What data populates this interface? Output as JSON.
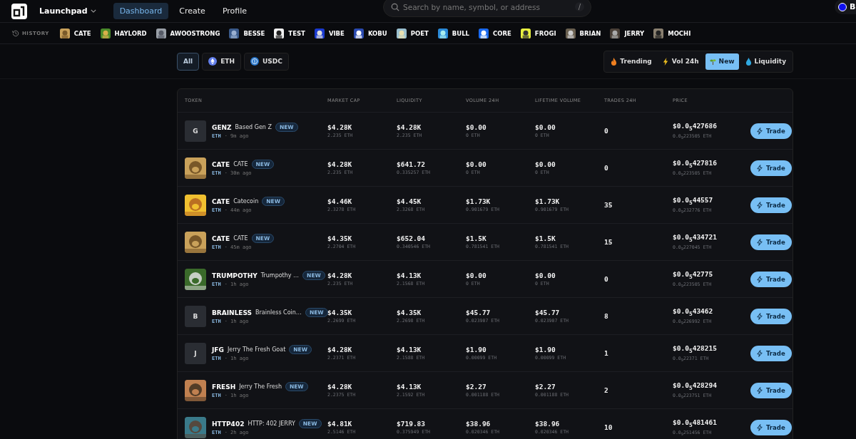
{
  "nav": {
    "brand": "Launchpad",
    "links": [
      {
        "label": "Dashboard",
        "selected": true
      },
      {
        "label": "Create",
        "selected": false
      },
      {
        "label": "Profile",
        "selected": false
      }
    ]
  },
  "search": {
    "placeholder": "Search by name, symbol, or address",
    "shortcut": "/"
  },
  "account": {
    "label": "B"
  },
  "history": {
    "label": "HISTORY",
    "items": [
      "CATE",
      "HAYLORD",
      "AWOOSTRONG",
      "BESSE",
      "TEST",
      "VIBE",
      "KOBU",
      "POET",
      "BULL",
      "CORE",
      "FROGI",
      "BRIAN",
      "JERRY",
      "MOCHI"
    ]
  },
  "chains": [
    {
      "label": "All",
      "kind": "all",
      "selected": true
    },
    {
      "label": "ETH",
      "kind": "eth",
      "selected": false
    },
    {
      "label": "USDC",
      "kind": "usdc",
      "selected": false
    }
  ],
  "sorts": [
    {
      "label": "Trending",
      "kind": "fire",
      "selected": false
    },
    {
      "label": "Vol 24h",
      "kind": "bolt",
      "selected": false
    },
    {
      "label": "New",
      "kind": "sprout",
      "selected": true
    },
    {
      "label": "Liquidity",
      "kind": "drop",
      "selected": false
    }
  ],
  "table": {
    "columns": [
      "TOKEN",
      "MARKET CAP",
      "LIQUIDITY",
      "VOLUME 24H",
      "LIFETIME VOLUME",
      "TRADES 24H",
      "PRICE"
    ],
    "rows": [
      {
        "avatar": {
          "kind": "letter",
          "letter": "G"
        },
        "symbol": "GENZ",
        "name": "Based Gen Z",
        "badge": "NEW",
        "chain": "ETH",
        "age": "· 9m ago",
        "mcap": "$4.28K",
        "mcap_eth": "2.235 ETH",
        "liq": "$4.28K",
        "liq_eth": "2.235 ETH",
        "vol": "$0.00",
        "vol_eth": "0 ETH",
        "life": "$0.00",
        "life_eth": "0 ETH",
        "trades": "0",
        "price": "$0.0$_{5}$427686",
        "price_eth": "0.0$_{9}$223505 ETH",
        "action": "Trade"
      },
      {
        "symbol": "CATE",
        "name": "CATE",
        "badge": "NEW",
        "chain": "ETH",
        "age": "· 30m ago",
        "mcap": "$4.28K",
        "mcap_eth": "2.235 ETH",
        "liq": "$641.72",
        "liq_eth": "0.335257 ETH",
        "vol": "$0.00",
        "vol_eth": "0 ETH",
        "life": "$0.00",
        "life_eth": "0 ETH",
        "trades": "0",
        "price": "$0.0$_{5}$427816",
        "price_eth": "0.0$_{9}$223505 ETH",
        "action": "Trade"
      },
      {
        "symbol": "CATE",
        "name": "Catecoin",
        "badge": "NEW",
        "chain": "ETH",
        "age": "· 44m ago",
        "mcap": "$4.46K",
        "mcap_eth": "2.3278 ETH",
        "liq": "$4.45K",
        "liq_eth": "2.3268 ETH",
        "vol": "$1.73K",
        "vol_eth": "0.901679 ETH",
        "life": "$1.73K",
        "life_eth": "0.901679 ETH",
        "trades": "35",
        "price": "$0.0$_{5}$44557",
        "price_eth": "0.0$_{9}$232776 ETH",
        "action": "Trade"
      },
      {
        "symbol": "CATE",
        "name": "CATE",
        "badge": "NEW",
        "chain": "ETH",
        "age": "· 45m ago",
        "mcap": "$4.35K",
        "mcap_eth": "2.2704 ETH",
        "liq": "$652.04",
        "liq_eth": "0.340546 ETH",
        "vol": "$1.5K",
        "vol_eth": "0.781541 ETH",
        "life": "$1.5K",
        "life_eth": "0.781541 ETH",
        "trades": "15",
        "price": "$0.0$_{5}$434721",
        "price_eth": "0.0$_{9}$227045 ETH",
        "action": "Trade"
      },
      {
        "symbol": "TRUMPOTHY",
        "name": "Trumpothy …",
        "badge": "NEW",
        "chain": "ETH",
        "age": "· 1h ago",
        "mcap": "$4.28K",
        "mcap_eth": "2.235 ETH",
        "liq": "$4.13K",
        "liq_eth": "2.1568 ETH",
        "vol": "$0.00",
        "vol_eth": "0 ETH",
        "life": "$0.00",
        "life_eth": "0 ETH",
        "trades": "0",
        "price": "$0.0$_{5}$42775",
        "price_eth": "0.0$_{9}$223505 ETH",
        "action": "Trade"
      },
      {
        "avatar": {
          "kind": "letter",
          "letter": "B"
        },
        "symbol": "BRAINLESS",
        "name": "Brainless Coin…",
        "badge": "NEW",
        "chain": "ETH",
        "age": "· 1h ago",
        "mcap": "$4.35K",
        "mcap_eth": "2.2699 ETH",
        "liq": "$4.35K",
        "liq_eth": "2.2698 ETH",
        "vol": "$45.77",
        "vol_eth": "0.023907 ETH",
        "life": "$45.77",
        "life_eth": "0.023907 ETH",
        "trades": "8",
        "price": "$0.0$_{5}$43462",
        "price_eth": "0.0$_{9}$226992 ETH",
        "action": "Trade"
      },
      {
        "avatar": {
          "kind": "letter",
          "letter": "J"
        },
        "symbol": "JFG",
        "name": "Jerry The Fresh Goat",
        "badge": "NEW",
        "chain": "ETH",
        "age": "· 1h ago",
        "mcap": "$4.28K",
        "mcap_eth": "2.2371 ETH",
        "liq": "$4.13K",
        "liq_eth": "2.1588 ETH",
        "vol": "$1.90",
        "vol_eth": "0.00099 ETH",
        "life": "$1.90",
        "life_eth": "0.00099 ETH",
        "trades": "1",
        "price": "$0.0$_{5}$428215",
        "price_eth": "0.0$_{9}$22371 ETH",
        "action": "Trade"
      },
      {
        "symbol": "FRESH",
        "name": "Jerry The Fresh",
        "badge": "NEW",
        "chain": "ETH",
        "age": "· 1h ago",
        "mcap": "$4.28K",
        "mcap_eth": "2.2375 ETH",
        "liq": "$4.13K",
        "liq_eth": "2.1592 ETH",
        "vol": "$2.27",
        "vol_eth": "0.001188 ETH",
        "life": "$2.27",
        "life_eth": "0.001188 ETH",
        "trades": "2",
        "price": "$0.0$_{5}$428294",
        "price_eth": "0.0$_{9}$223751 ETH",
        "action": "Trade"
      },
      {
        "symbol": "HTTP402",
        "name": "HTTP: 402 JERRY",
        "badge": "NEW",
        "chain": "ETH",
        "age": "· 2h ago",
        "mcap": "$4.81K",
        "mcap_eth": "2.5146 ETH",
        "liq": "$719.83",
        "liq_eth": "0.375949 ETH",
        "vol": "$38.96",
        "vol_eth": "0.020346 ETH",
        "life": "$38.96",
        "life_eth": "0.020346 ETH",
        "trades": "10",
        "price": "$0.0$_{5}$481461",
        "price_eth": "0.0$_{9}$251456 ETH",
        "action": "Trade"
      }
    ]
  }
}
